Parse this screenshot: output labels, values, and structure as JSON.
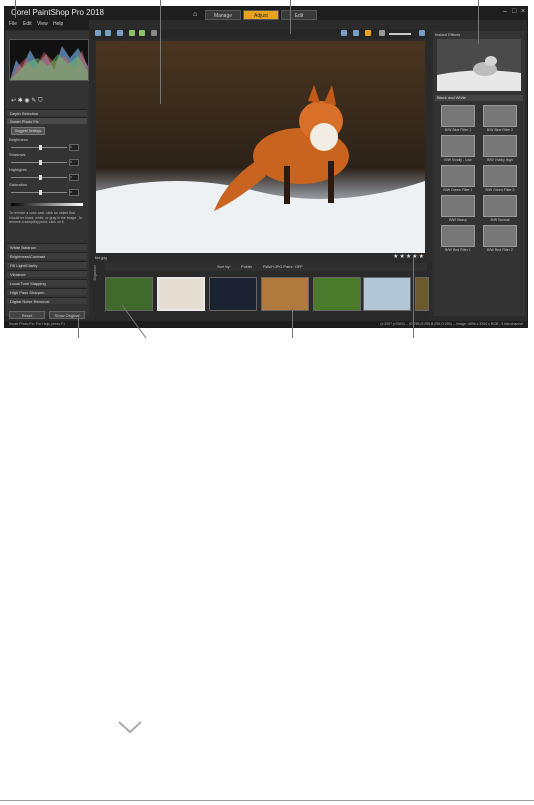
{
  "app": {
    "title": "Corel PaintShop Pro 2018",
    "menus": [
      "File",
      "Edit",
      "View",
      "Help"
    ],
    "tabs": [
      "Manage",
      "Adjust",
      "Edit"
    ],
    "active_tab": "Adjust"
  },
  "left_panel": {
    "sections": [
      "Depth Selection",
      "Smart Photo Fix",
      "White Balance",
      "Brightness/Contrast",
      "Fill Light/Clarity",
      "Vibrance",
      "Local Tone Mapping",
      "High Pass Sharpen",
      "Digital Noise Removal"
    ],
    "suggest_button": "Suggest Settings",
    "sliders": [
      "Brightness",
      "Shadows",
      "Highlights",
      "Saturation"
    ],
    "slider_values": [
      "0",
      "0",
      "0",
      "0"
    ],
    "help_text": "To remove a color cast, click an object that should be black, white, or gray in the image. To remove a sampling point, click on it.",
    "buttons": {
      "reset": "Reset",
      "show_original": "Show Original"
    },
    "status_hint": "Smart Photo Fix: For Help, press F1"
  },
  "right_panel": {
    "title": "Instant Effects",
    "category": "Black and White",
    "filters": [
      "B/W Blue Filter 1",
      "B/W Blue Filter 2",
      "B/W Vividly - Low",
      "B/W Vividly High",
      "B/W Green Filter 1",
      "B/W Green Filter 2",
      "B/W Heavy",
      "B/W Normal",
      "B/W Red Filter 1",
      "B/W Red Filter 2"
    ]
  },
  "organizer": {
    "filename": "fox.jpg",
    "sort_label": "Sort by:",
    "sort_value": "Folder",
    "filter_value": "RAW+JPG Pairs: OFF",
    "side_label": "Organizer",
    "stars": "★★★★★",
    "thumb_colors": [
      "#3f6a2b",
      "#e4ddd2",
      "#1c2333",
      "#b07a3e",
      "#4b7b2a",
      "#b3c6d8",
      "#6b5a2e"
    ]
  },
  "status": {
    "left": "Smart Photo Fix: For Help, press F1",
    "right": "(x:2097 y:3063) -- (R:255,G:255,B:255,O:255) -- Image: 4896 x 3264 x RGB - 8 bits/channel"
  },
  "colors": {
    "accent": "#e8a21b",
    "ui_bg": "#2b2b2b"
  },
  "icons": [
    "home-icon",
    "undo-icon",
    "redo-icon",
    "zoom-icon",
    "star-icon",
    "chevron-down-icon"
  ]
}
